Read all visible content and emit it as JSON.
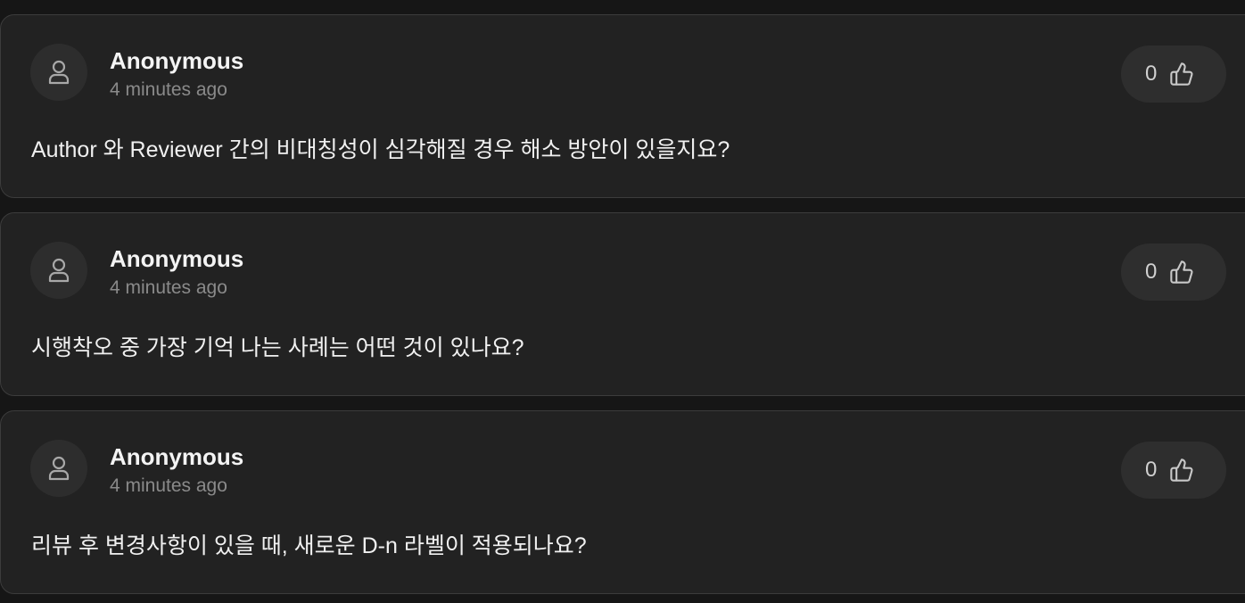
{
  "comments": [
    {
      "author": "Anonymous",
      "time": "4 minutes ago",
      "likes": "0",
      "text": "Author 와 Reviewer 간의 비대칭성이 심각해질 경우 해소 방안이 있을지요?",
      "avatar_icon": "user-icon",
      "like_icon": "thumbs-up-icon"
    },
    {
      "author": "Anonymous",
      "time": "4 minutes ago",
      "likes": "0",
      "text": "시행착오 중 가장 기억 나는 사례는 어떤 것이 있나요?",
      "avatar_icon": "user-icon",
      "like_icon": "thumbs-up-icon"
    },
    {
      "author": "Anonymous",
      "time": "4 minutes ago",
      "likes": "0",
      "text": "리뷰 후 변경사항이 있을 때, 새로운 D-n 라벨이 적용되나요?",
      "avatar_icon": "user-icon",
      "like_icon": "thumbs-up-icon"
    }
  ],
  "colors": {
    "background": "#161616",
    "card": "#222222",
    "card_border": "#3c3c3c",
    "author_text": "#f4f4f4",
    "muted_text": "#8a8a8a",
    "button_bg": "#2e2e2e"
  }
}
